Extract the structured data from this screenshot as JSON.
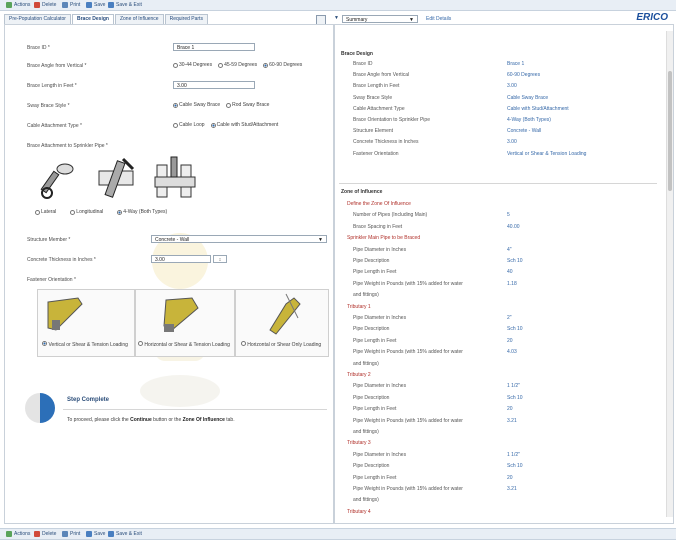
{
  "toolbar": {
    "items": [
      "Actions",
      "Delete",
      "Print",
      "Save",
      "Save & Exit"
    ]
  },
  "tabs": [
    "Pre-Population Calculator",
    "Brace Design",
    "Zone of Influence",
    "Required Parts"
  ],
  "active_tab": 1,
  "form": {
    "brace_id_label": "Brace ID *",
    "brace_id_value": "Brace 1",
    "angle_label": "Brace Angle from Vertical *",
    "angle_options": [
      "30-44 Degrees",
      "45-59 Degrees",
      "60-90 Degrees"
    ],
    "angle_selected": 2,
    "length_label": "Brace Length in Feet *",
    "length_value": "3.00",
    "style_label": "Sway Brace Style *",
    "style_options": [
      "Cable Sway Brace",
      "Rod Sway Brace"
    ],
    "style_selected": 0,
    "attachment_label": "Cable Attachment Type *",
    "attachment_options": [
      "Cable Loop",
      "Cable with Stud/Attachment"
    ],
    "attachment_selected": 1,
    "sprinkler_label": "Brace Attachment to Sprinkler Pipe *",
    "clamp_options": [
      "Lateral",
      "Longitudinal",
      "4-Way (Both Types)"
    ],
    "clamp_selected": 2,
    "structure_label": "Structure Member *",
    "structure_value": "Concrete - Wall",
    "thickness_label": "Concrete Thickness in Inches *",
    "thickness_value": "3.00",
    "fastener_label": "Fastener Orientation *",
    "fastener_options": [
      "Vertical or Shear & Tension Loading",
      "Horizontal or Shear & Tension Loading",
      "Horizontal or Shear Only Loading"
    ],
    "fastener_selected": 0
  },
  "step": {
    "title": "Step Complete",
    "text_before": "To proceed, please click the ",
    "text_bold1": "Continue",
    "text_middle": " button or the ",
    "text_bold2": "Zone Of Influence",
    "text_after": " tab."
  },
  "right_header": {
    "select_value": "Summary",
    "link": "Edit Details",
    "brand": "ERICO"
  },
  "summary": {
    "brace_title": "Brace Design",
    "brace_rows": [
      {
        "k": "Brace ID",
        "v": "Brace 1"
      },
      {
        "k": "Brace Angle from Vertical",
        "v": "60-90 Degrees"
      },
      {
        "k": "Brace Length in Feet",
        "v": "3.00"
      },
      {
        "k": "Sway Brace Style",
        "v": "Cable Sway Brace"
      },
      {
        "k": "Cable Attachment Type",
        "v": "Cable with Stud/Attachment"
      },
      {
        "k": "Brace Orientation to Sprinkler Pipe",
        "v": "4-Way (Both Types)"
      },
      {
        "k": "Structure Element",
        "v": "Concrete - Wall"
      },
      {
        "k": "Concrete Thickness in Inches",
        "v": "3.00"
      },
      {
        "k": "Fastener Orientation",
        "v": "Vertical or Shear & Tension Loading"
      }
    ],
    "zone_title": "Zone of Influence",
    "zone_rows": [
      {
        "k": "Define the Zone Of Influence",
        "v": "",
        "red": true
      },
      {
        "k": "Number of Pipes (Including Main)",
        "v": "5"
      },
      {
        "k": "Brace Spacing in Feet",
        "v": "40.00"
      },
      {
        "k": "Sprinkler Main Pipe to be Braced",
        "v": "",
        "red": true
      },
      {
        "k": "Pipe Diameter in Inches",
        "v": "4\""
      },
      {
        "k": "Pipe Description",
        "v": "Sch 10"
      },
      {
        "k": "Pipe Length in Feet",
        "v": "40"
      },
      {
        "k": "Pipe Weight in Pounds (with 15% added for water",
        "v": "1.18"
      },
      {
        "k": "and fittings)",
        "v": ""
      },
      {
        "k": "Tributary 1",
        "v": "",
        "red": true
      },
      {
        "k": "Pipe Diameter in Inches",
        "v": "2\""
      },
      {
        "k": "Pipe Description",
        "v": "Sch 10"
      },
      {
        "k": "Pipe Length in Feet",
        "v": "20"
      },
      {
        "k": "Pipe Weight in Pounds (with 15% added for water",
        "v": "4.03"
      },
      {
        "k": "and fittings)",
        "v": ""
      },
      {
        "k": "Tributary 2",
        "v": "",
        "red": true
      },
      {
        "k": "Pipe Diameter in Inches",
        "v": "1 1/2\""
      },
      {
        "k": "Pipe Description",
        "v": "Sch 10"
      },
      {
        "k": "Pipe Length in Feet",
        "v": "20"
      },
      {
        "k": "Pipe Weight in Pounds (with 15% added for water",
        "v": "3.21"
      },
      {
        "k": "and fittings)",
        "v": ""
      },
      {
        "k": "Tributary 3",
        "v": "",
        "red": true
      },
      {
        "k": "Pipe Diameter in Inches",
        "v": "1 1/2\""
      },
      {
        "k": "Pipe Description",
        "v": "Sch 10"
      },
      {
        "k": "Pipe Length in Feet",
        "v": "20"
      },
      {
        "k": "Pipe Weight in Pounds (with 15% added for water",
        "v": "3.21"
      },
      {
        "k": "and fittings)",
        "v": ""
      },
      {
        "k": "Tributary 4",
        "v": "",
        "red": true
      }
    ]
  },
  "colors": {
    "brand": "#1b4f9c",
    "accent": "#2c6fb8",
    "red": "#b0302a"
  }
}
